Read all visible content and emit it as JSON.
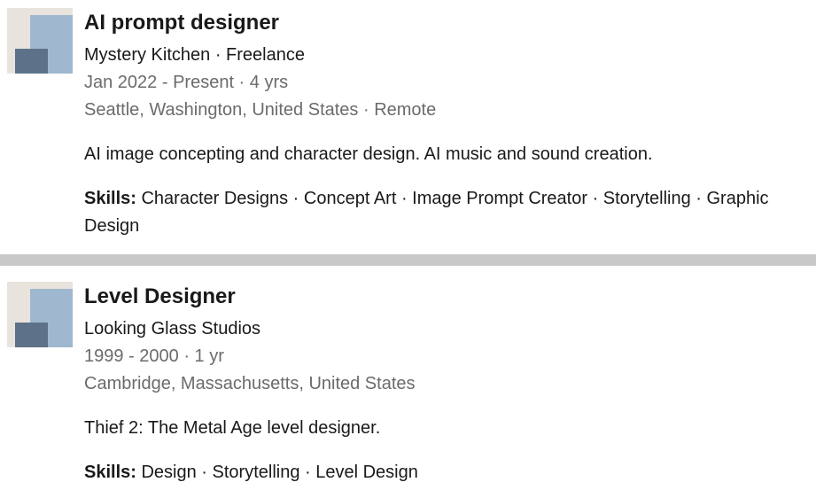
{
  "experiences": [
    {
      "title": "AI prompt designer",
      "company": "Mystery Kitchen · Freelance",
      "dates": "Jan 2022 - Present · 4 yrs",
      "location": "Seattle, Washington, United States · Remote",
      "description": "AI image concepting and character design. AI music and sound creation.",
      "skills_label": "Skills:",
      "skills": "Character Designs · Concept Art · Image Prompt Creator · Storytelling · Graphic Design"
    },
    {
      "title": "Level Designer",
      "company": "Looking Glass Studios",
      "dates": "1999 - 2000 · 1 yr",
      "location": "Cambridge, Massachusetts, United States",
      "description": "Thief 2: The Metal Age level designer.",
      "skills_label": "Skills:",
      "skills": "Design · Storytelling · Level Design"
    }
  ]
}
